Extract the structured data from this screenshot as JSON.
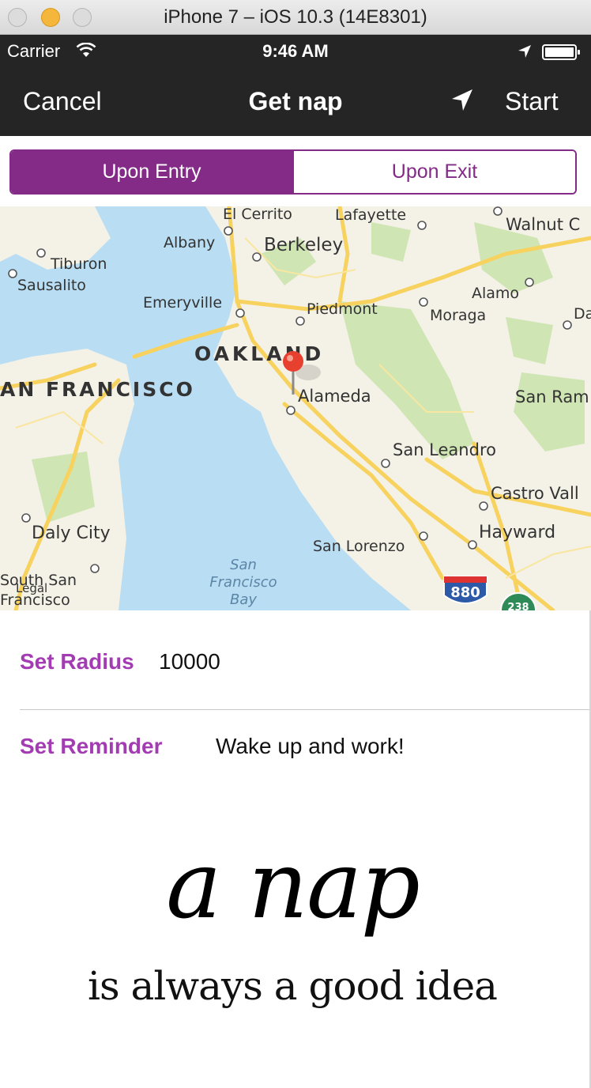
{
  "simulator": {
    "title": "iPhone 7 – iOS 10.3 (14E8301)"
  },
  "status_bar": {
    "carrier": "Carrier",
    "time": "9:46 AM"
  },
  "nav": {
    "cancel_label": "Cancel",
    "title": "Get nap",
    "start_label": "Start"
  },
  "segments": [
    {
      "label": "Upon Entry",
      "selected": true
    },
    {
      "label": "Upon Exit",
      "selected": false
    }
  ],
  "map": {
    "labels": {
      "el_cerrito": "El Cerrito",
      "lafayette": "Lafayette",
      "walnut_creek": "Walnut C",
      "albany": "Albany",
      "berkeley": "Berkeley",
      "tiburon": "Tiburon",
      "sausalito": "Sausalito",
      "emeryville": "Emeryville",
      "piedmont": "Piedmont",
      "alamo": "Alamo",
      "moraga": "Moraga",
      "danville": "Da",
      "oakland": "OAKLAND",
      "san_francisco": "AN FRANCISCO",
      "alameda": "Alameda",
      "san_ramon": "San Ram",
      "san_leandro": "San Leandro",
      "castro_valley": "Castro Vall",
      "daly_city": "Daly City",
      "hayward": "Hayward",
      "san_lorenzo": "San Lorenzo",
      "south_sf_1": "South San",
      "south_sf_2": "Francisco",
      "legal": "Legal",
      "bay_1": "San",
      "bay_2": "Francisco",
      "bay_3": "Bay",
      "shield_880": "880",
      "shield_238": "238"
    },
    "colors": {
      "water": "#b9ddf2",
      "land": "#f4f1e6",
      "park": "#cfe6b4",
      "road": "#f7d25e",
      "pin": "#e8402f"
    }
  },
  "form": {
    "radius_label": "Set Radius",
    "radius_value": "10000",
    "reminder_label": "Set Reminder",
    "reminder_value": "Wake up and work!"
  },
  "tagline": {
    "line1": "a nap",
    "line2": "is always a good idea"
  },
  "colors": {
    "accent": "#832b87",
    "label": "#a33bb2",
    "nav_bg": "#252525"
  }
}
